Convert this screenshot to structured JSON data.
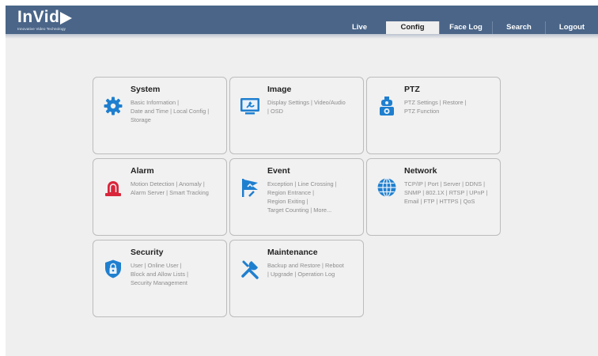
{
  "app": {
    "logo_text": "InVid",
    "logo_tagline": "Innovative Video Technology"
  },
  "nav": {
    "tabs": [
      {
        "label": "Live",
        "active": false
      },
      {
        "label": "Config",
        "active": true
      },
      {
        "label": "Face Log",
        "active": false
      },
      {
        "label": "Search",
        "active": false
      },
      {
        "label": "Logout",
        "active": false
      }
    ]
  },
  "cards": {
    "system": {
      "title": "System",
      "lines": [
        "Basic Information |",
        "Date and Time | Local Config |",
        "Storage"
      ],
      "icon": "gear-icon"
    },
    "image": {
      "title": "Image",
      "lines": [
        "Display Settings | Video/Audio",
        "| OSD"
      ],
      "icon": "monitor-settings-icon"
    },
    "ptz": {
      "title": "PTZ",
      "lines": [
        "PTZ Settings | Restore |",
        "PTZ Function"
      ],
      "icon": "ptz-camera-icon"
    },
    "alarm": {
      "title": "Alarm",
      "lines": [
        "Motion Detection | Anomaly |",
        "Alarm Server | Smart Tracking"
      ],
      "icon": "alarm-light-icon"
    },
    "event": {
      "title": "Event",
      "lines": [
        "Exception | Line Crossing |",
        "Region Entrance |",
        "Region Exiting |",
        "Target Counting | More..."
      ],
      "icon": "event-flag-icon"
    },
    "network": {
      "title": "Network",
      "lines": [
        "TCP/IP | Port | Server | DDNS |",
        "SNMP | 802.1X | RTSP | UPnP |",
        "Email | FTP | HTTPS | QoS"
      ],
      "icon": "globe-icon"
    },
    "security": {
      "title": "Security",
      "lines": [
        "User | Online User |",
        "Block and Allow Lists |",
        "Security Management"
      ],
      "icon": "shield-lock-icon"
    },
    "maintenance": {
      "title": "Maintenance",
      "lines": [
        "Backup and Restore  | Reboot",
        "| Upgrade | Operation Log"
      ],
      "icon": "tools-icon"
    }
  },
  "colors": {
    "header": "#4a6588",
    "icon_blue": "#1f7fcf",
    "icon_red": "#d9253a",
    "page_bg": "#efefef"
  }
}
